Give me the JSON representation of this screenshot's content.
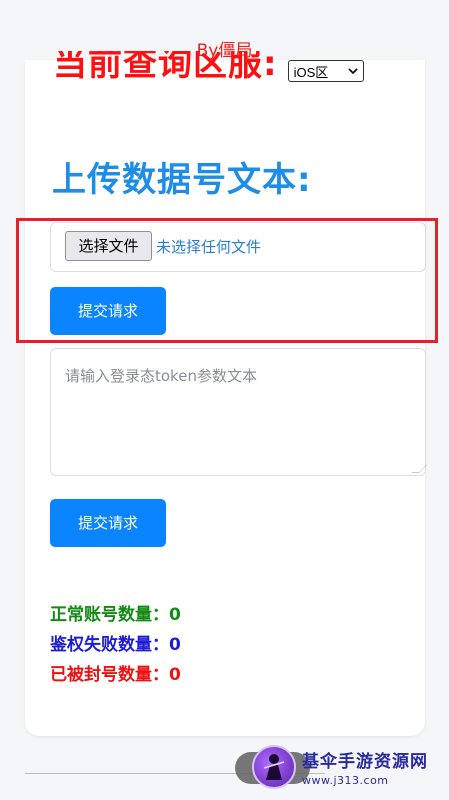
{
  "header": {
    "byline": "By僵局"
  },
  "region": {
    "label": "当前查询区服:",
    "selected": "iOS区"
  },
  "upload": {
    "title": "上传数据号文本:",
    "choose_label": "选择文件",
    "no_file_text": "未选择任何文件",
    "submit_label": "提交请求"
  },
  "token": {
    "placeholder": "请输入登录态token参数文本",
    "submit_label": "提交请求"
  },
  "stats": {
    "normal": "正常账号数量：0",
    "auth_failed": "鉴权失败数量：0",
    "banned": "已被封号数量：0"
  },
  "watermark": {
    "name": "基伞手游资源网",
    "url": "www.j313.com"
  },
  "colors": {
    "region_label": "#ff1010",
    "upload_title": "#1e8de8",
    "button_bg": "#0a84ff",
    "highlight_border": "#e5202b",
    "stat_normal": "#138a13",
    "stat_auth": "#1c1cd6",
    "stat_banned": "#ee1111"
  }
}
